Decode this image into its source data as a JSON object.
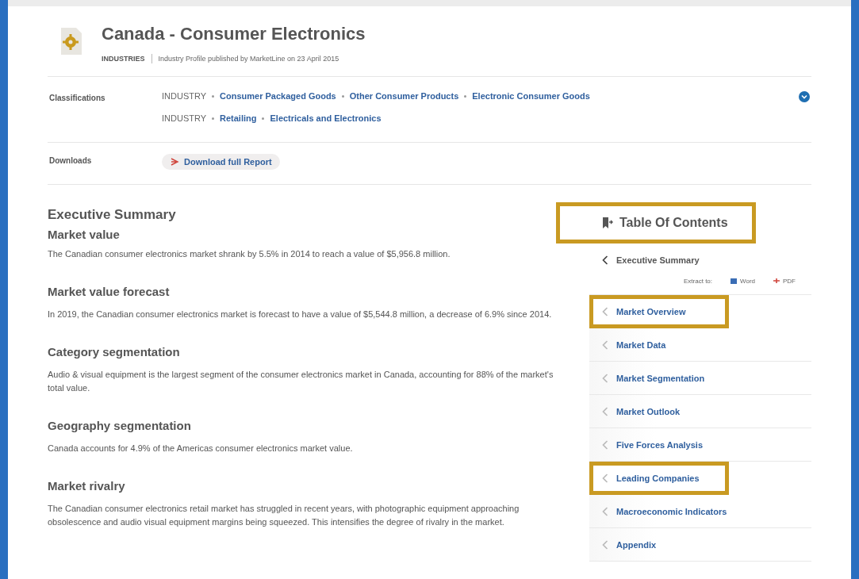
{
  "header": {
    "title": "Canada - Consumer Electronics",
    "category": "INDUSTRIES",
    "subtitle": "Industry Profile published by MarketLine on 23 April 2015"
  },
  "classifications": {
    "label": "Classifications",
    "rows": [
      {
        "prefix": "INDUSTRY",
        "links": [
          "Consumer Packaged Goods",
          "Other Consumer Products",
          "Electronic Consumer Goods"
        ]
      },
      {
        "prefix": "INDUSTRY",
        "links": [
          "Retailing",
          "Electricals and Electronics"
        ]
      }
    ]
  },
  "downloads": {
    "label": "Downloads",
    "button": "Download full Report"
  },
  "summary": {
    "title": "Executive Summary",
    "sections": [
      {
        "heading": "Market value",
        "text": "The Canadian consumer electronics market shrank by 5.5% in 2014 to reach a value of $5,956.8 million."
      },
      {
        "heading": "Market value forecast",
        "text": "In 2019, the Canadian consumer electronics market is forecast to have a value of $5,544.8 million, a decrease of 6.9% since 2014."
      },
      {
        "heading": "Category segmentation",
        "text": "Audio & visual equipment is the largest segment of the consumer electronics market in Canada, accounting for 88% of the market's total value."
      },
      {
        "heading": "Geography segmentation",
        "text": "Canada accounts for 4.9% of the Americas consumer electronics market value."
      },
      {
        "heading": "Market rivalry",
        "text": "The Canadian consumer electronics retail market has struggled in recent years, with photographic equipment approaching obsolescence and audio visual equipment margins being squeezed. This intensifies the degree of rivalry in the market."
      }
    ]
  },
  "toc": {
    "title": "Table Of Contents",
    "highlighted": true,
    "extract": {
      "label": "Extract to:",
      "word": "Word",
      "pdf": "PDF"
    },
    "items": [
      {
        "label": "Executive Summary",
        "selected": true,
        "highlighted": false
      },
      {
        "label": "Market Overview",
        "selected": false,
        "highlighted": true
      },
      {
        "label": "Market Data",
        "selected": false,
        "highlighted": false
      },
      {
        "label": "Market Segmentation",
        "selected": false,
        "highlighted": false
      },
      {
        "label": "Market Outlook",
        "selected": false,
        "highlighted": false
      },
      {
        "label": "Five Forces Analysis",
        "selected": false,
        "highlighted": false
      },
      {
        "label": "Leading Companies",
        "selected": false,
        "highlighted": true
      },
      {
        "label": "Macroeconomic Indicators",
        "selected": false,
        "highlighted": false
      },
      {
        "label": "Appendix",
        "selected": false,
        "highlighted": false
      }
    ]
  }
}
